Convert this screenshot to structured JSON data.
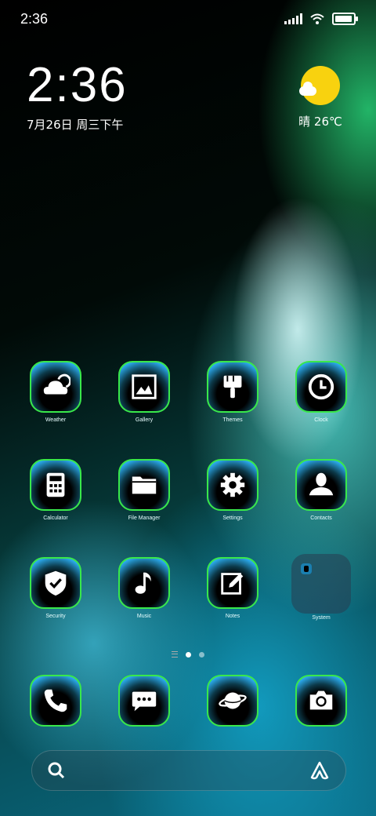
{
  "status_bar": {
    "time": "2:36",
    "icons": [
      "signal-icon",
      "wifi-icon",
      "battery-icon"
    ]
  },
  "clock_widget": {
    "time": "2:36",
    "date": "7月26日 周三下午"
  },
  "weather_widget": {
    "condition_icon": "sun-cloud-icon",
    "text": "晴 26℃"
  },
  "apps": [
    {
      "label": "Weather",
      "icon": "weather-icon"
    },
    {
      "label": "Gallery",
      "icon": "gallery-icon"
    },
    {
      "label": "Themes",
      "icon": "brush-icon"
    },
    {
      "label": "Clock",
      "icon": "clock-icon"
    },
    {
      "label": "Calculator",
      "icon": "calculator-icon"
    },
    {
      "label": "File Manager",
      "icon": "folder-icon"
    },
    {
      "label": "Settings",
      "icon": "gear-icon"
    },
    {
      "label": "Contacts",
      "icon": "person-icon"
    },
    {
      "label": "Security",
      "icon": "shield-icon"
    },
    {
      "label": "Music",
      "icon": "music-note-icon"
    },
    {
      "label": "Notes",
      "icon": "note-edit-icon"
    },
    {
      "label": "System",
      "icon": "folder-system-icon"
    }
  ],
  "dock": [
    {
      "icon": "phone-icon"
    },
    {
      "icon": "messages-icon"
    },
    {
      "icon": "browser-planet-icon"
    },
    {
      "icon": "camera-icon"
    }
  ],
  "page_indicator": {
    "pages": 2,
    "active": 1
  },
  "search_bar": {
    "left_icon": "search-icon",
    "right_icon": "assistant-icon"
  },
  "colors": {
    "icon_border": "#39e84a",
    "sun": "#f8d20f"
  }
}
